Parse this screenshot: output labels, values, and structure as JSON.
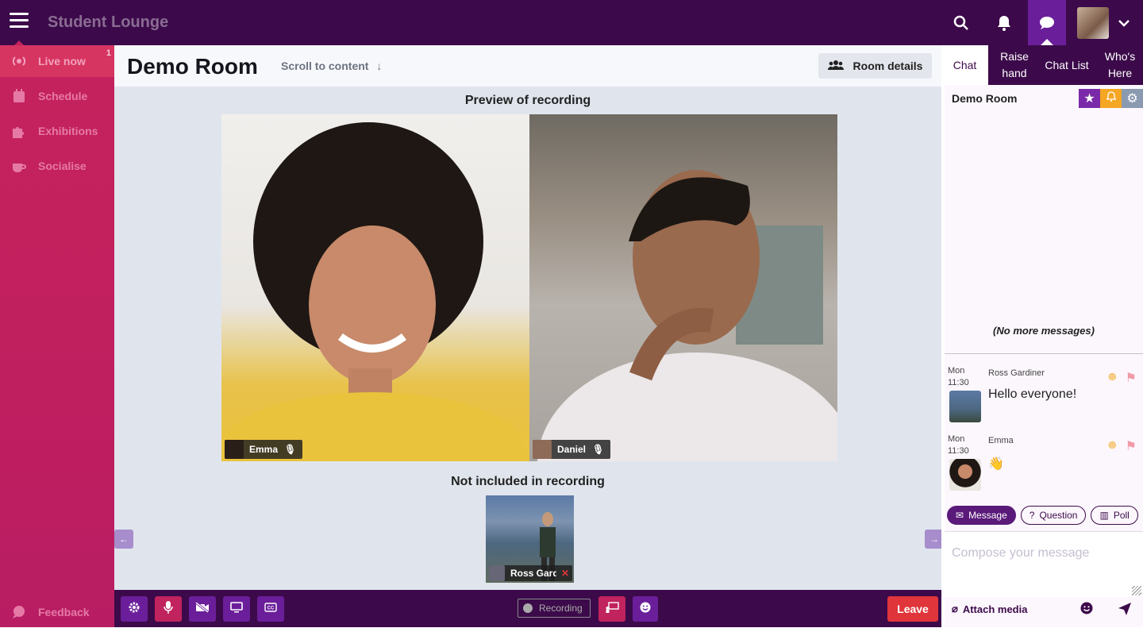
{
  "app": {
    "title": "Student Lounge"
  },
  "topbar": {
    "icons": [
      "menu-icon",
      "search-icon",
      "bell-icon",
      "chat-bubble-icon",
      "user-avatar",
      "chevron-down-icon"
    ]
  },
  "sidebar": {
    "items": [
      {
        "label": "Live now",
        "icon": "broadcast-icon",
        "badge": "1",
        "active": true
      },
      {
        "label": "Schedule",
        "icon": "calendar-icon"
      },
      {
        "label": "Exhibitions",
        "icon": "puzzle-icon"
      },
      {
        "label": "Socialise",
        "icon": "coffee-icon"
      }
    ],
    "feedback": "Feedback"
  },
  "room": {
    "title": "Demo Room",
    "scroll_label": "Scroll to content",
    "details_label": "Room details",
    "preview_heading": "Preview of recording",
    "excluded_heading": "Not included in recording"
  },
  "participants": [
    {
      "name": "Emma",
      "mic": "on"
    },
    {
      "name": "Daniel",
      "mic": "on"
    },
    {
      "name": "Ross Gard",
      "mic": "muted"
    }
  ],
  "controls": {
    "recording_label": "Recording",
    "leave_label": "Leave",
    "buttons": [
      "settings-icon",
      "microphone-icon",
      "camera-off-icon",
      "screen-share-icon",
      "captions-icon"
    ]
  },
  "chat": {
    "tabs": [
      {
        "label": "Chat",
        "active": true
      },
      {
        "label": "Raise hand"
      },
      {
        "label": "Chat List"
      },
      {
        "label": "Who's Here"
      }
    ],
    "room_name": "Demo Room",
    "no_more": "(No more messages)",
    "messages": [
      {
        "day": "Mon",
        "time": "11:30",
        "author": "Ross Gardiner",
        "text": "Hello everyone!"
      },
      {
        "day": "Mon",
        "time": "11:30",
        "author": "Emma",
        "text": "👋"
      }
    ],
    "modes": [
      "Message",
      "Question",
      "Poll"
    ],
    "compose_placeholder": "Compose your message",
    "attach_label": "Attach media"
  },
  "colors": {
    "topbar": "#3c0a4a",
    "sidebar": "#c01f5f",
    "accent": "#6b1e9a",
    "leave": "#e0353a"
  }
}
